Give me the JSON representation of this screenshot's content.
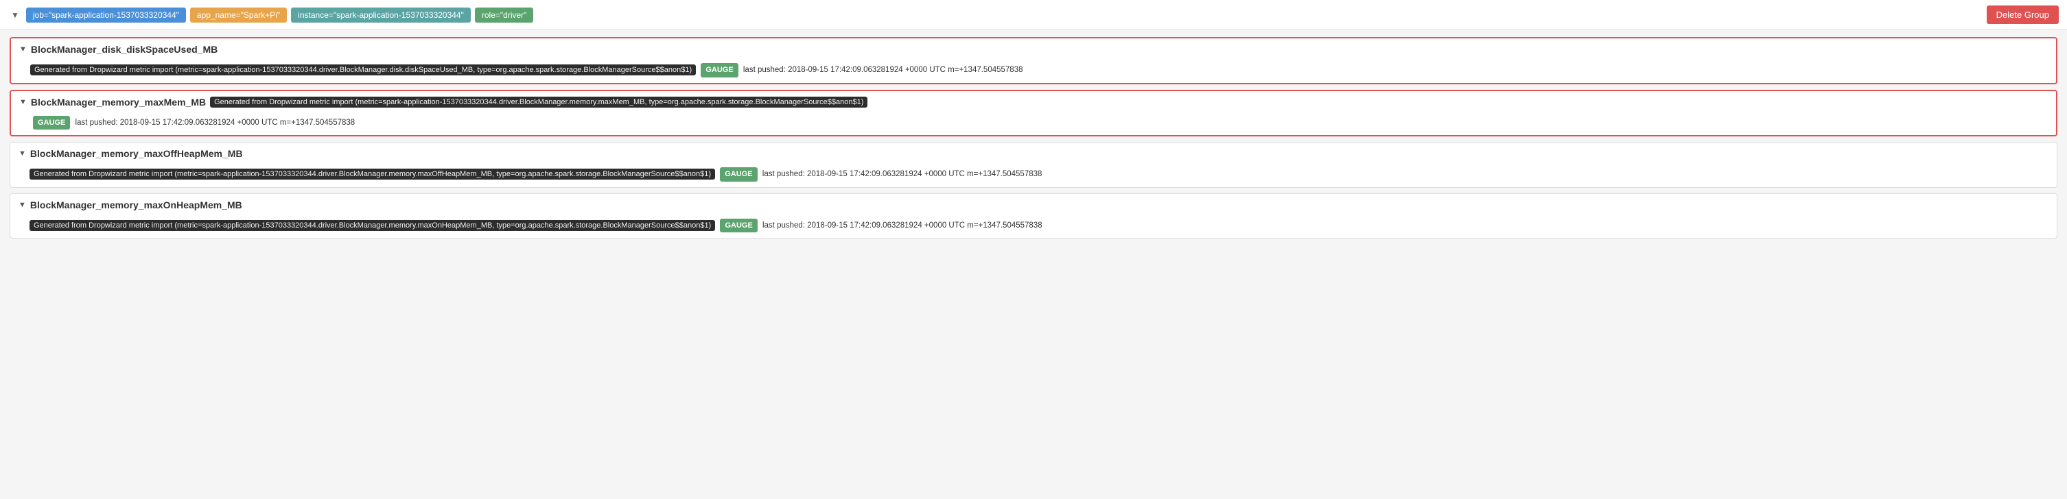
{
  "topbar": {
    "chevron": "▼",
    "tags": [
      {
        "id": "job-tag",
        "label": "job=\"spark-application-1537033320344\"",
        "color": "tag-blue"
      },
      {
        "id": "app-tag",
        "label": "app_name=\"Spark+Pi\"",
        "color": "tag-orange"
      },
      {
        "id": "instance-tag",
        "label": "instance=\"spark-application-1537033320344\"",
        "color": "tag-teal"
      },
      {
        "id": "role-tag",
        "label": "role=\"driver\"",
        "color": "tag-green"
      }
    ],
    "delete_button": "Delete Group"
  },
  "metrics": [
    {
      "id": "metric-1",
      "name": "BlockManager_disk_diskSpaceUsed_MB",
      "highlighted": true,
      "description": "Generated from Dropwizard metric import (metric=spark-application-1537033320344.driver.BlockManager.disk.diskSpaceUsed_MB, type=org.apache.spark.storage.BlockManagerSource$$anon$1)",
      "badge": "GAUGE",
      "last_pushed": "last pushed: 2018-09-15 17:42:09.063281924 +0000 UTC m=+1347.504557838"
    },
    {
      "id": "metric-2",
      "name": "BlockManager_memory_maxMem_MB",
      "highlighted": true,
      "description": "Generated from Dropwizard metric import (metric=spark-application-1537033320344.driver.BlockManager.memory.maxMem_MB, type=org.apache.spark.storage.BlockManagerSource$$anon$1)",
      "badge": "GAUGE",
      "last_pushed": "last pushed: 2018-09-15 17:42:09.063281924 +0000 UTC m=+1347.504557838"
    },
    {
      "id": "metric-3",
      "name": "BlockManager_memory_maxOffHeapMem_MB",
      "highlighted": false,
      "description": "Generated from Dropwizard metric import (metric=spark-application-1537033320344.driver.BlockManager.memory.maxOffHeapMem_MB, type=org.apache.spark.storage.BlockManagerSource$$anon$1)",
      "badge": "GAUGE",
      "last_pushed": "last pushed: 2018-09-15 17:42:09.063281924 +0000 UTC m=+1347.504557838"
    },
    {
      "id": "metric-4",
      "name": "BlockManager_memory_maxOnHeapMem_MB",
      "highlighted": false,
      "description": "Generated from Dropwizard metric import (metric=spark-application-1537033320344.driver.BlockManager.memory.maxOnHeapMem_MB, type=org.apache.spark.storage.BlockManagerSource$$anon$1)",
      "badge": "GAUGE",
      "last_pushed": "last pushed: 2018-09-15 17:42:09.063281924 +0000 UTC m=+1347.504557838"
    }
  ]
}
